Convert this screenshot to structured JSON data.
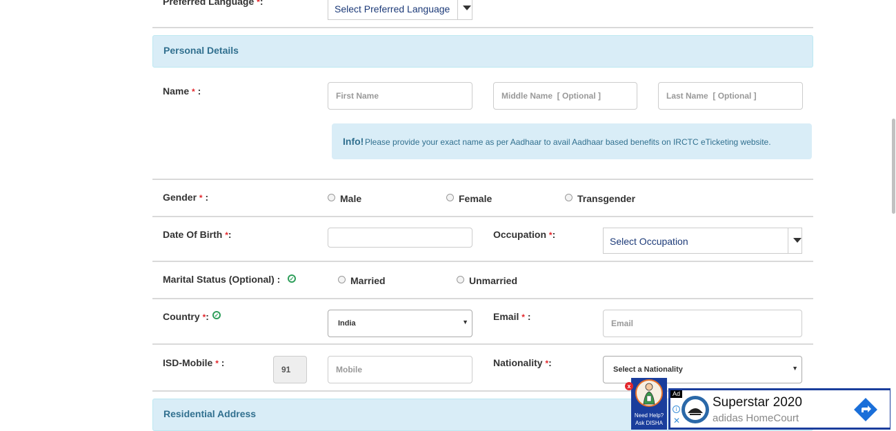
{
  "preferred_language": {
    "label": "Preferred Language",
    "req": "*",
    "colon": ":",
    "select": "Select Preferred Language"
  },
  "personal_details": {
    "heading": "Personal Details"
  },
  "name": {
    "label": "Name",
    "req": "*",
    "colon": ":",
    "first_placeholder": "First Name",
    "middle_placeholder": "Middle Name  [ Optional ]",
    "last_placeholder": "Last Name  [ Optional ]"
  },
  "info": {
    "strong": "Info!",
    "text": "Please provide your exact name as per Aadhaar to avail Aadhaar based benefits on IRCTC eTicketing website."
  },
  "gender": {
    "label": "Gender",
    "req": "*",
    "colon": ":",
    "options": [
      "Male",
      "Female",
      "Transgender"
    ]
  },
  "dob": {
    "label": "Date Of Birth",
    "req": "*",
    "colon": ":"
  },
  "occupation": {
    "label": "Occupation",
    "req": "*",
    "colon": ":",
    "select": "Select Occupation"
  },
  "marital": {
    "label": "Marital Status (Optional) :",
    "options": [
      "Married",
      "Unmarried"
    ]
  },
  "country": {
    "label": "Country",
    "req": "*",
    "colon": ":",
    "value": "India"
  },
  "email": {
    "label": "Email",
    "req": "*",
    "colon": ":",
    "placeholder": "Email"
  },
  "isd": {
    "label": "ISD-Mobile",
    "req": "*",
    "colon": ":",
    "code": "91",
    "mobile_placeholder": "Mobile"
  },
  "nationality": {
    "label": "Nationality",
    "req": "*",
    "colon": ":",
    "select": "Select a Nationality"
  },
  "residential": {
    "heading": "Residential Address"
  },
  "disha": {
    "line1": "Need Help?",
    "line2": "Ask DISHA",
    "close": "x"
  },
  "ad": {
    "badge": "Ad",
    "title": "Superstar 2020",
    "subtitle": "adidas HomeCourt",
    "info": "i",
    "close": "✕"
  },
  "colors": {
    "accent": "#31708f",
    "required": "#e3262b",
    "check": "#2e9e5a",
    "ad_border": "#1a3d9c"
  }
}
